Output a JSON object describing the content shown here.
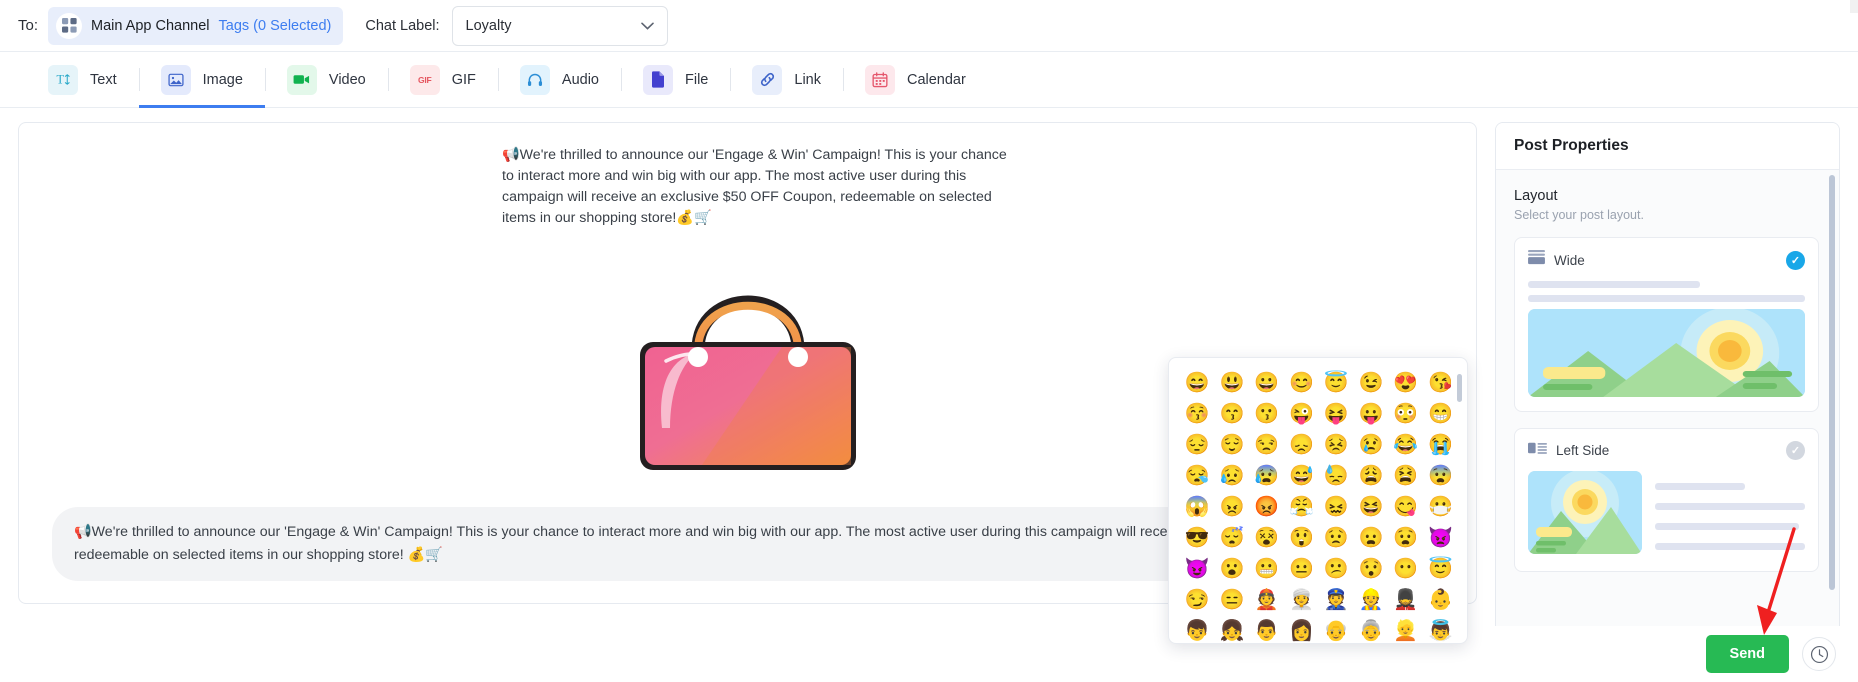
{
  "topbar": {
    "to_label": "To:",
    "channel_icon": "grid-icon",
    "channel_name": "Main App Channel",
    "tags_link": "Tags (0 Selected)",
    "chat_label_text": "Chat Label:",
    "chat_label_value": "Loyalty",
    "chat_label_caret": "chevron-down-icon"
  },
  "tabs": [
    {
      "label": "Text",
      "icon": "text-format-icon",
      "active": false
    },
    {
      "label": "Image",
      "icon": "image-icon",
      "active": true
    },
    {
      "label": "Video",
      "icon": "video-camera-icon",
      "active": false
    },
    {
      "label": "GIF",
      "icon": "gif-icon",
      "active": false
    },
    {
      "label": "Audio",
      "icon": "headphones-icon",
      "active": false
    },
    {
      "label": "File",
      "icon": "document-icon",
      "active": false
    },
    {
      "label": "Link",
      "icon": "link-chain-icon",
      "active": false
    },
    {
      "label": "Calendar",
      "icon": "calendar-icon",
      "active": false
    }
  ],
  "editor": {
    "preview_text": "📢We're thrilled to announce our 'Engage & Win' Campaign! This is your chance to interact more and win big with our app. The most active user during this campaign will receive an exclusive $50 OFF Coupon, redeemable on selected items in our shopping store!💰🛒",
    "attachment_image": "pink-handbag-image",
    "composer_text": "📢We're thrilled to announce our 'Engage & Win' Campaign! This is your chance to interact more and win big with our app. The most active user during this campaign will receive an exclusive $50 OFF Coupon, redeemable on selected items in our shopping store! 💰🛒",
    "emoji_button_icon": "smiley-face-icon"
  },
  "emoji_picker": {
    "visible": true,
    "emojis": [
      "😄",
      "😃",
      "😀",
      "😊",
      "😇",
      "😉",
      "😍",
      "😘",
      "😚",
      "😙",
      "😗",
      "😜",
      "😝",
      "😛",
      "😳",
      "😁",
      "😔",
      "😌",
      "😒",
      "😞",
      "😣",
      "😢",
      "😂",
      "😭",
      "😪",
      "😥",
      "😰",
      "😅",
      "😓",
      "😩",
      "😫",
      "😨",
      "😱",
      "😠",
      "😡",
      "😤",
      "😖",
      "😆",
      "😋",
      "😷",
      "😎",
      "😴",
      "😵",
      "😲",
      "😟",
      "😦",
      "😧",
      "👿",
      "😈",
      "😮",
      "😬",
      "😐",
      "😕",
      "😯",
      "😶",
      "😇",
      "😏",
      "😑",
      "👲",
      "👳",
      "👮",
      "👷",
      "💂",
      "👶",
      "👦",
      "👧",
      "👨",
      "👩",
      "👴",
      "👵",
      "👱",
      "👼"
    ]
  },
  "properties": {
    "title": "Post Properties",
    "layout_section": {
      "title": "Layout",
      "subtitle": "Select your post layout.",
      "options": [
        {
          "name": "Wide",
          "icon": "wide-layout-icon",
          "selected": true
        },
        {
          "name": "Left Side",
          "icon": "leftside-layout-icon",
          "selected": false
        }
      ]
    }
  },
  "footer": {
    "send_label": "Send",
    "schedule_icon": "clock-icon",
    "annotation": "red-arrow-annotation"
  },
  "colors": {
    "accent_blue": "#3d7df0",
    "link_blue": "#3d7df0",
    "send_green": "#27ba54",
    "check_blue": "#19a7e8",
    "annotation_red": "#ef2020"
  }
}
